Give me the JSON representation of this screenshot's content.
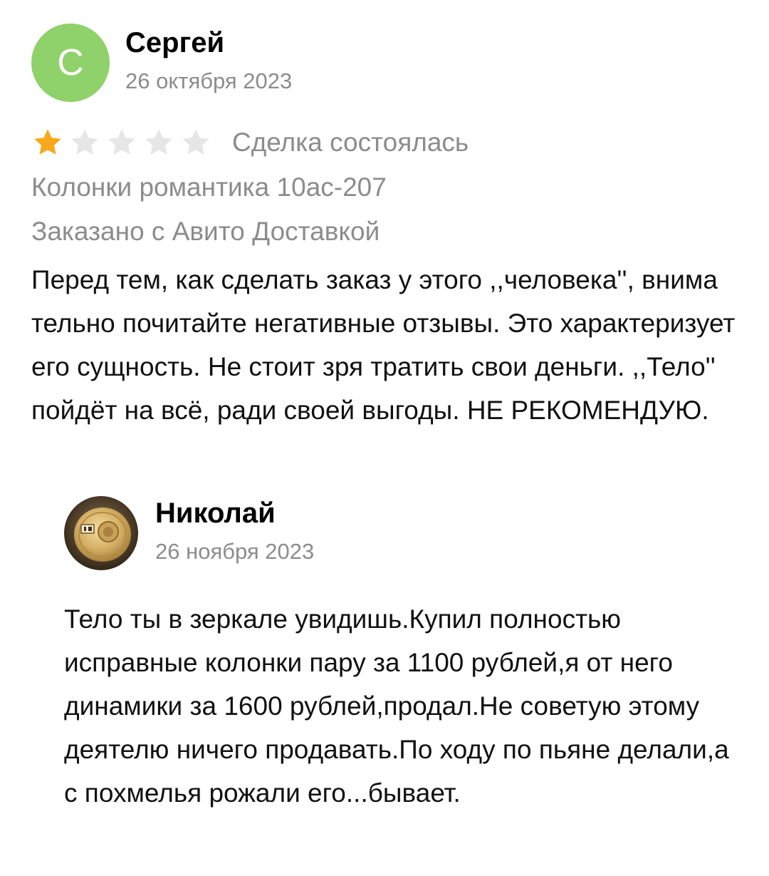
{
  "review": {
    "author": {
      "initial": "С",
      "name": "Сергей",
      "date": "26 октября 2023",
      "avatar_color": "#8fd16a"
    },
    "rating": {
      "value": 1,
      "max": 5,
      "filled_color": "#f7a81b",
      "empty_color": "#e6e6e6"
    },
    "deal_status": "Сделка состоялась",
    "product": "Колонки романтика 10ас-207",
    "delivery": "Заказано с Авито Доставкой",
    "text": "Перед тем, как сделать заказ у этого ,,человека'', внима тельно почитайте негативные отзывы. Это характеризует его сущность. Не стоит зря тратить свои деньги. ,,Тело'' пойдёт на всё, ради своей выгоды. НЕ РЕКОМЕНДУЮ."
  },
  "reply": {
    "author": {
      "name": "Николай",
      "date": "26 ноября 2023",
      "avatar_icon": "coin-photo-icon"
    },
    "text": "Тело ты в зеркале увидишь.Купил полностью исправные колонки пару за 1100 рублей,я от него динамики за 1600 рублей,продал.Не советую этому деятелю ничего продавать.По ходу по пьяне делали,а с похмелья рожали его...бывает."
  }
}
